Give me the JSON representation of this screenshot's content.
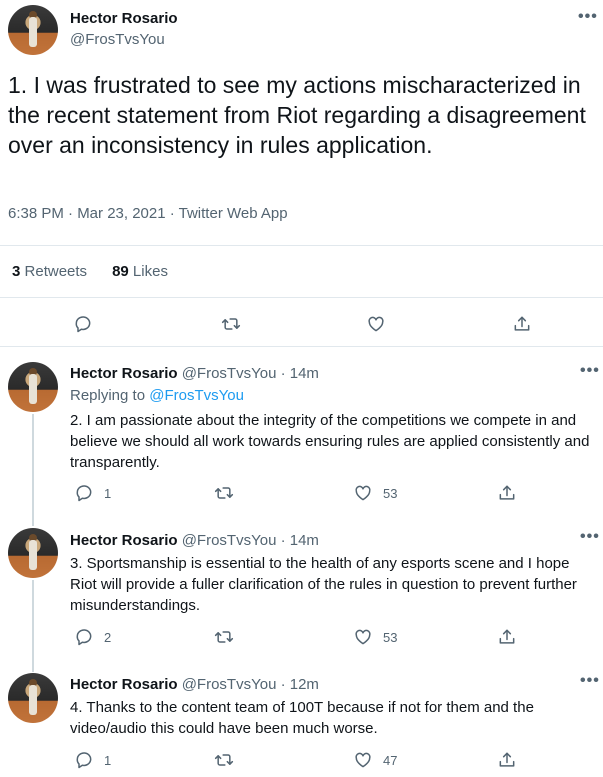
{
  "main_tweet": {
    "author_name": "Hector Rosario",
    "author_handle": "@FrosTvsYou",
    "text": "1.  I was frustrated to see my actions mischaracterized in the recent statement from Riot regarding a disagreement over an inconsistency in rules application.",
    "timestamp": "6:38 PM · Mar 23, 2021 · Twitter Web App",
    "retweets_count": "3",
    "retweets_label": "Retweets",
    "likes_count": "89",
    "likes_label": "Likes",
    "more_icon": "•••"
  },
  "replies": [
    {
      "author_name": "Hector Rosario",
      "meta": "@FrosTvsYou · 14m",
      "replying_prefix": "Replying to",
      "replying_to": "@FrosTvsYou",
      "text": "2. I am passionate about the integrity of the competitions we compete in and believe we should all work towards ensuring rules are applied consistently and transparently.",
      "reply_count": "1",
      "like_count": "53"
    },
    {
      "author_name": "Hector Rosario",
      "meta": "@FrosTvsYou · 14m",
      "text": "3. Sportsmanship is essential to the health of any esports scene and I hope Riot will provide a fuller clarification of the rules in question to prevent further misunderstandings.",
      "reply_count": "2",
      "like_count": "53"
    },
    {
      "author_name": "Hector Rosario",
      "meta": "@FrosTvsYou · 12m",
      "text": "4. Thanks to the content team of 100T because if not for them and the video/audio this could have been much worse.",
      "reply_count": "1",
      "like_count": "47"
    }
  ],
  "icons": {
    "reply": "reply-icon",
    "retweet": "retweet-icon",
    "like": "heart-icon",
    "share": "share-icon",
    "more": "more-icon"
  },
  "colors": {
    "text": "#0f1419",
    "secondary": "#536471",
    "link": "#1d9bf0",
    "divider": "#e1e8ed"
  }
}
